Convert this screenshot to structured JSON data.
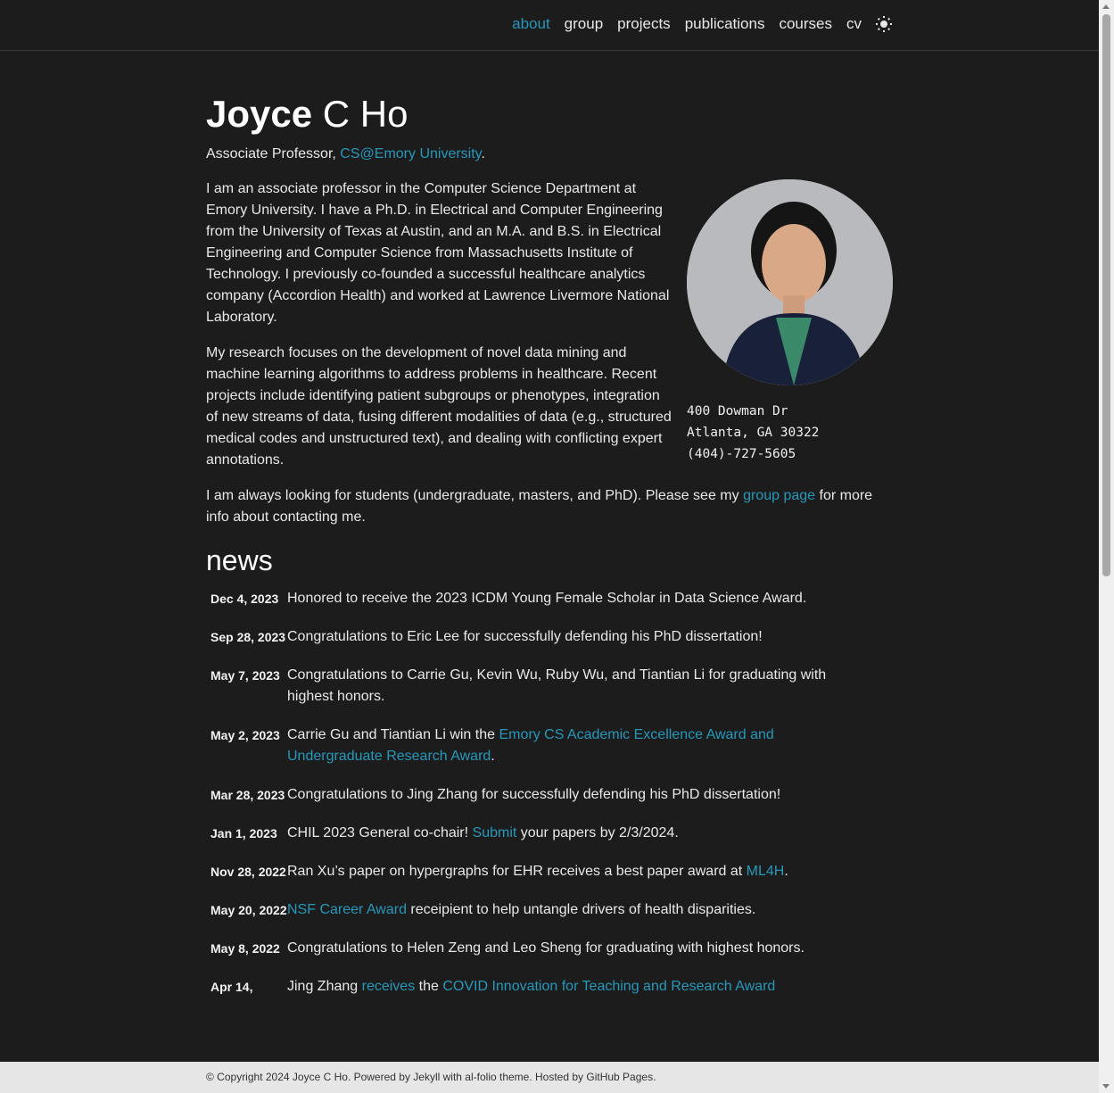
{
  "nav": {
    "items": [
      "about",
      "group",
      "projects",
      "publications",
      "courses",
      "cv"
    ],
    "active": "about",
    "theme_icon": "sun-icon"
  },
  "header": {
    "first_name": "Joyce",
    "rest_name": "C Ho",
    "desc_prefix": "Associate Professor, ",
    "desc_link": "CS@Emory University",
    "desc_suffix": "."
  },
  "profile": {
    "address": [
      "400 Dowman Dr",
      "Atlanta, GA 30322",
      "(404)-727-5605"
    ]
  },
  "bio": {
    "p1": "I am an associate professor in the Computer Science Department at Emory University. I have a Ph.D. in Electrical and Computer Engineering from the University of Texas at Austin, and an M.A. and B.S. in Electrical Engineering and Computer Science from Massachusetts Institute of Technology. I previously co-founded a successful healthcare analytics company (Accordion Health) and worked at Lawrence Livermore National Laboratory.",
    "p2": "My research focuses on the development of novel data mining and machine learning algorithms to address problems in healthcare. Recent projects include identifying patient subgroups or phenotypes, integration of new streams of data, fusing different modalities of data (e.g., structured medical codes and unstructured text), and dealing with conflicting expert annotations.",
    "p3_prefix": "I am always looking for students (undergraduate, masters, and PhD). Please see my ",
    "p3_link": "group page",
    "p3_suffix": " for more info about contacting me."
  },
  "news": {
    "heading": "news",
    "items": [
      {
        "date": "Dec 4, 2023",
        "parts": [
          {
            "t": "Honored to receive the 2023 ICDM Young Female Scholar in Data Science Award."
          }
        ]
      },
      {
        "date": "Sep 28, 2023",
        "parts": [
          {
            "t": "Congratulations to Eric Lee for successfully defending his PhD dissertation!"
          }
        ]
      },
      {
        "date": "May 7, 2023",
        "parts": [
          {
            "t": "Congratulations to Carrie Gu, Kevin Wu, Ruby Wu, and Tiantian Li for graduating with highest honors."
          }
        ]
      },
      {
        "date": "May 2, 2023",
        "parts": [
          {
            "t": "Carrie Gu and Tiantian Li win the "
          },
          {
            "t": "Emory CS Academic Excellence Award and Undergraduate Research Award",
            "link": true
          },
          {
            "t": "."
          }
        ]
      },
      {
        "date": "Mar 28, 2023",
        "parts": [
          {
            "t": "Congratulations to Jing Zhang for successfully defending his PhD dissertation!"
          }
        ]
      },
      {
        "date": "Jan 1, 2023",
        "parts": [
          {
            "t": "CHIL 2023 General co-chair! "
          },
          {
            "t": "Submit",
            "link": true
          },
          {
            "t": " your papers by 2/3/2024."
          }
        ]
      },
      {
        "date": "Nov 28, 2022",
        "parts": [
          {
            "t": "Ran Xu’s paper on hypergraphs for EHR receives a best paper award at "
          },
          {
            "t": "ML4H",
            "link": true
          },
          {
            "t": "."
          }
        ]
      },
      {
        "date": "May 20, 2022",
        "parts": [
          {
            "t": "NSF Career Award",
            "link": true
          },
          {
            "t": " receipient to help untangle drivers of health disparities."
          }
        ]
      },
      {
        "date": "May 8, 2022",
        "parts": [
          {
            "t": "Congratulations to Helen Zeng and Leo Sheng for graduating with highest honors."
          }
        ]
      },
      {
        "date": "Apr 14,",
        "parts": [
          {
            "t": "Jing Zhang "
          },
          {
            "t": "receives",
            "link": true
          },
          {
            "t": " the "
          },
          {
            "t": "COVID Innovation for Teaching and Research Award",
            "link": true
          }
        ]
      }
    ]
  },
  "footer": {
    "text": "© Copyright 2024 Joyce C Ho. Powered by Jekyll with al-folio theme. Hosted by GitHub Pages."
  }
}
